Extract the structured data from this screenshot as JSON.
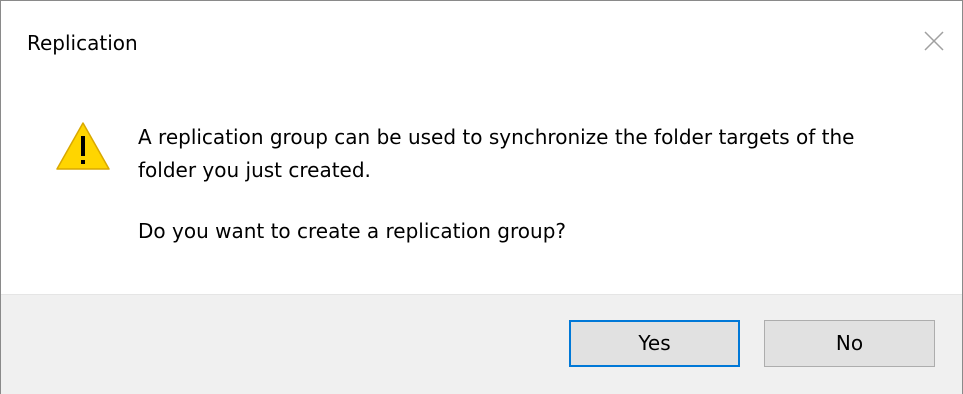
{
  "window": {
    "title": "Replication",
    "close_icon": "close-icon"
  },
  "message": {
    "icon": "warning-icon",
    "line1": "A replication group can be used to synchronize the folder targets of the",
    "line2": "folder you just created.",
    "question": "Do you want to create a replication group?"
  },
  "buttons": {
    "yes_label": "Yes",
    "no_label": "No",
    "default": "yes"
  },
  "colors": {
    "warning_fill": "#FFD500",
    "warning_glyph": "#000000",
    "default_button_border": "#0078D7",
    "footer_background": "#F0F0F0"
  }
}
